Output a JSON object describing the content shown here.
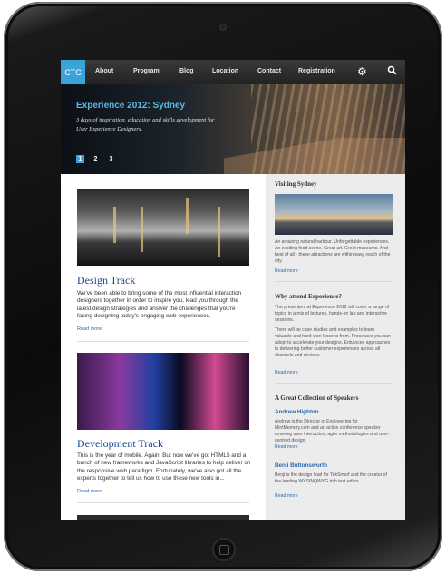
{
  "nav": {
    "logo": "CTC",
    "items": [
      "About",
      "Program",
      "Blog",
      "Location",
      "Contact",
      "Registration"
    ],
    "icons": [
      "gear-icon",
      "search-icon"
    ]
  },
  "hero": {
    "title": "Experience 2012: Sydney",
    "description": "3 days of inspiration, education and skills development for User Experience Designers.",
    "pages": [
      "1",
      "2",
      "3"
    ],
    "active_page": "1"
  },
  "articles": [
    {
      "title": "Design Track",
      "text": "We've been able to bring some of the most influential interaction designers together in order to inspire you, lead you through the latest design strategies and answer the challenges that you're facing designing today's engaging web experiences.",
      "link": "Read more"
    },
    {
      "title": "Development Track",
      "text": "This is the year of mobile. Again. But now we've got HTML5 and a bunch of new frameworks and JavaScript libraries to help deliver on the responsive web paradigm. Fortunately, we've also got all the experts together to tell us how to use these new tools in...",
      "link": "Read more"
    }
  ],
  "sidebar": {
    "visiting": {
      "heading": "Visiting Sydney",
      "text": "An amazing natural harbour. Unforgettable experiences. An exciting food scene. Great art. Great museums. And best of all - these attractions are within easy reach of the city.",
      "link": "Read more"
    },
    "why": {
      "heading": "Why attend Experience?",
      "text1": "The presenters at Experience 2012 will cover a range of topics in a mix of lectures, hands-on lab and interactive sessions.",
      "text2": "There will be case studies and examples to learn valuable and hard-won lessons from. Processes you can adopt to accelerate your designs. Enhanced approaches to delivering better customer experiences across all channels and devices.",
      "link": "Read more"
    },
    "speakers": {
      "heading": "A Great Collection of Speakers",
      "list": [
        {
          "name": "Andrew Highton",
          "bio": "Andrew is the Director of Engineering for MintMemory.com and an active conference speaker covering user interaction, agile methodologies and user-centred design.",
          "link": "Read more"
        },
        {
          "name": "Benji Buttonsworth",
          "bio": "Benji is the design lead for TekSmurf and the creator of the leading WYSINQWYG rich text editor.",
          "link": "Read more"
        }
      ]
    }
  }
}
